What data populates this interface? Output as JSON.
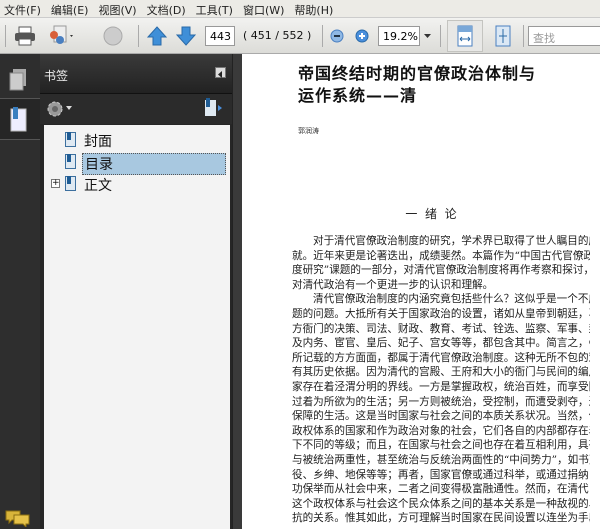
{
  "menu": [
    "文件(F)",
    "编辑(E)",
    "视图(V)",
    "文档(D)",
    "工具(T)",
    "窗口(W)",
    "帮助(H)"
  ],
  "toolbar": {
    "page_number": "443",
    "page_info": "( 451 / 552 )",
    "zoom": "19.2%",
    "search_placeholder": "查找"
  },
  "panel": {
    "title": "书签",
    "bookmarks": [
      {
        "label": "封面"
      },
      {
        "label": "目录",
        "selected": true
      },
      {
        "label": "正文",
        "expandable": true
      }
    ]
  },
  "document": {
    "title_lines": [
      "帝国终结时期的官僚政治体制与",
      "运作系统——清"
    ],
    "author": "郭润涛",
    "section_heading": "一  绪  论",
    "lines": [
      "对于清代官僚政治制度的研究，学术界已取得了世人瞩目的成",
      "就。近年来更是论著迭出，成绩斐然。本篇作为“中国古代官僚政治制",
      "度研究”课题的一部分，对清代官僚政治制度将再作考察和探讨，以期",
      "对清代政治有一个更进一步的认识和理解。",
      "清代官僚政治制度的内涵究竟包括些什么？这似乎是一个不成问",
      "题的问题。大抵所有关于国家政治的设置，诸如从皇帝到朝廷，再到地",
      "方衙门的决策、司法、财政、教育、考试、铨选、监察、军事、封赏、祭祀，以",
      "及内务、宦官、皇后、妃子、宫女等等，都包含其中。简言之，《大清会典》",
      "所记载的方方面面，都属于清代官僚政治制度。这种无所不包的观念，",
      "有其历史依据。因为清代的宫殿、王府和大小的衙门与民间的编户人",
      "家存在着泾渭分明的界线。一方是掌握政权，统治百姓，而享受国帑，",
      "过着为所欲为的生活；另一方则被统治，受控制，而遭受剥夺，过着缺乏",
      "保障的生活。这是当时国家与社会之间的本质关系状况。当然，作为",
      "政权体系的国家和作为政治对象的社会，它们各自的内部都存在着高",
      "下不同的等级；而且，在国家与社会之间也存在着互相利用，具有统治",
      "与被统治两重性，甚至统治与反统治两面性的“中间势力”，如书吏、衙",
      "役、乡绅、地保等等；再者，国家官僚或通过科举，或通过捐纳，或通过军",
      "功保举而从社会中来，二者之间变得极富融通性。然而，在清代，国家",
      "这个政权体系与社会这个民众体系之间的基本关系是一种敌视的、对",
      "抗的关系。惟其如此，方可理解当时国家在民间设置以连坐为手段的"
    ]
  }
}
